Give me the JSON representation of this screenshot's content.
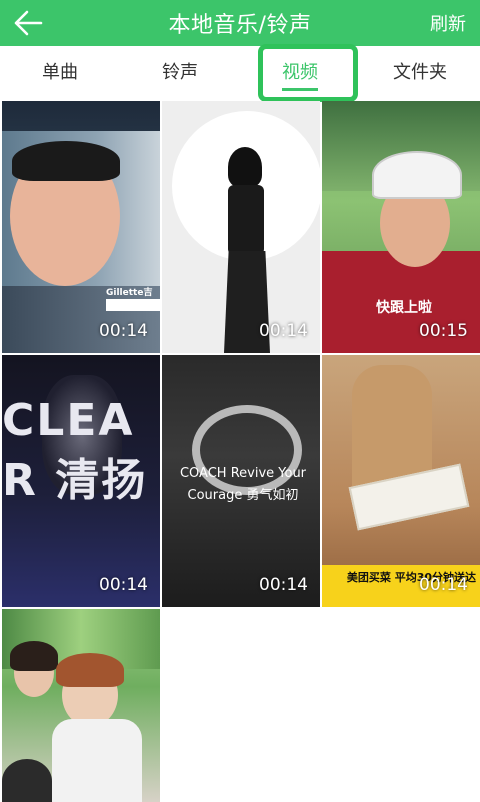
{
  "header": {
    "title": "本地音乐/铃声",
    "refresh_label": "刷新",
    "background_color": "#3cc56a"
  },
  "tabs": [
    {
      "label": "单曲",
      "active": false
    },
    {
      "label": "铃声",
      "active": false
    },
    {
      "label": "视频",
      "active": true
    },
    {
      "label": "文件夹",
      "active": false
    }
  ],
  "videos": [
    {
      "duration": "00:14",
      "overlay": "Gillette吉列"
    },
    {
      "duration": "00:14",
      "overlay": ""
    },
    {
      "duration": "00:15",
      "overlay": "快跟上啦"
    },
    {
      "duration": "00:14",
      "overlay": "CLEAR 清扬"
    },
    {
      "duration": "00:14",
      "overlay": "COACH Revive Your Courage 勇气如初"
    },
    {
      "duration": "00:14",
      "overlay": "美团买菜 平均30分钟送达"
    },
    {
      "duration": "",
      "overlay": ""
    }
  ],
  "accent_color": "#3cc56a"
}
